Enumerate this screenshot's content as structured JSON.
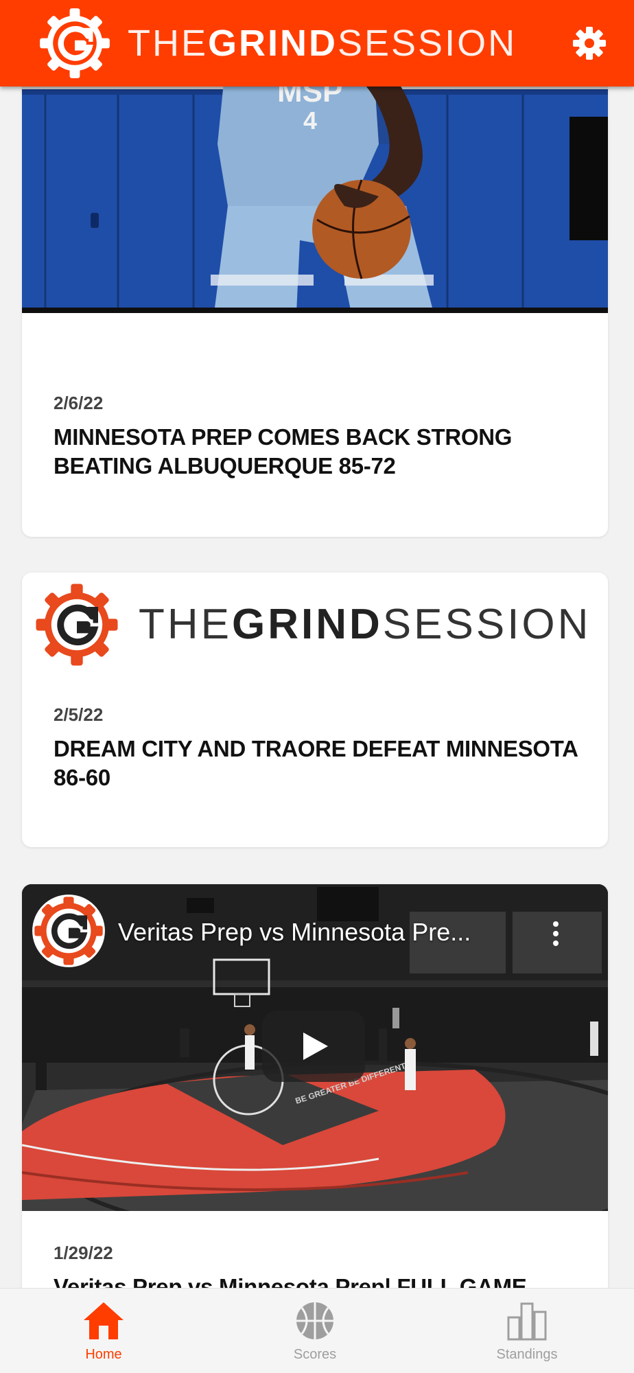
{
  "header": {
    "brand_prefix": "THE",
    "brand_bold": "GRIND",
    "brand_suffix": "SESSION",
    "accent_color": "#ff3d00",
    "settings_icon": "gear-icon"
  },
  "feed": {
    "cards": [
      {
        "type": "photo",
        "jersey_text": "MSP",
        "jersey_number": "4",
        "date": "2/6/22",
        "title": "MINNESOTA PREP COMES BACK STRONG BEATING ALBUQUERQUE 85-72"
      },
      {
        "type": "logo",
        "brand_prefix": "THE",
        "brand_bold": "GRIND",
        "brand_suffix": "SESSION",
        "date": "2/5/22",
        "title": "DREAM CITY AND TRAORE DEFEAT MINNESOTA 86-60"
      },
      {
        "type": "video",
        "video_title": "Veritas Prep vs Minnesota Pre...",
        "court_text": "BE GREATER BE DIFFERENT",
        "date": "1/29/22",
        "title": "Veritas Prep vs Minnesota Prep| FULL GAME"
      }
    ]
  },
  "bottom_nav": {
    "items": [
      {
        "label": "Home",
        "icon": "home-icon",
        "active": true,
        "color": "#ff3d00"
      },
      {
        "label": "Scores",
        "icon": "basketball-icon",
        "active": false,
        "color": "#9e9e9e"
      },
      {
        "label": "Standings",
        "icon": "bar-chart-icon",
        "active": false,
        "color": "#9e9e9e"
      }
    ]
  }
}
